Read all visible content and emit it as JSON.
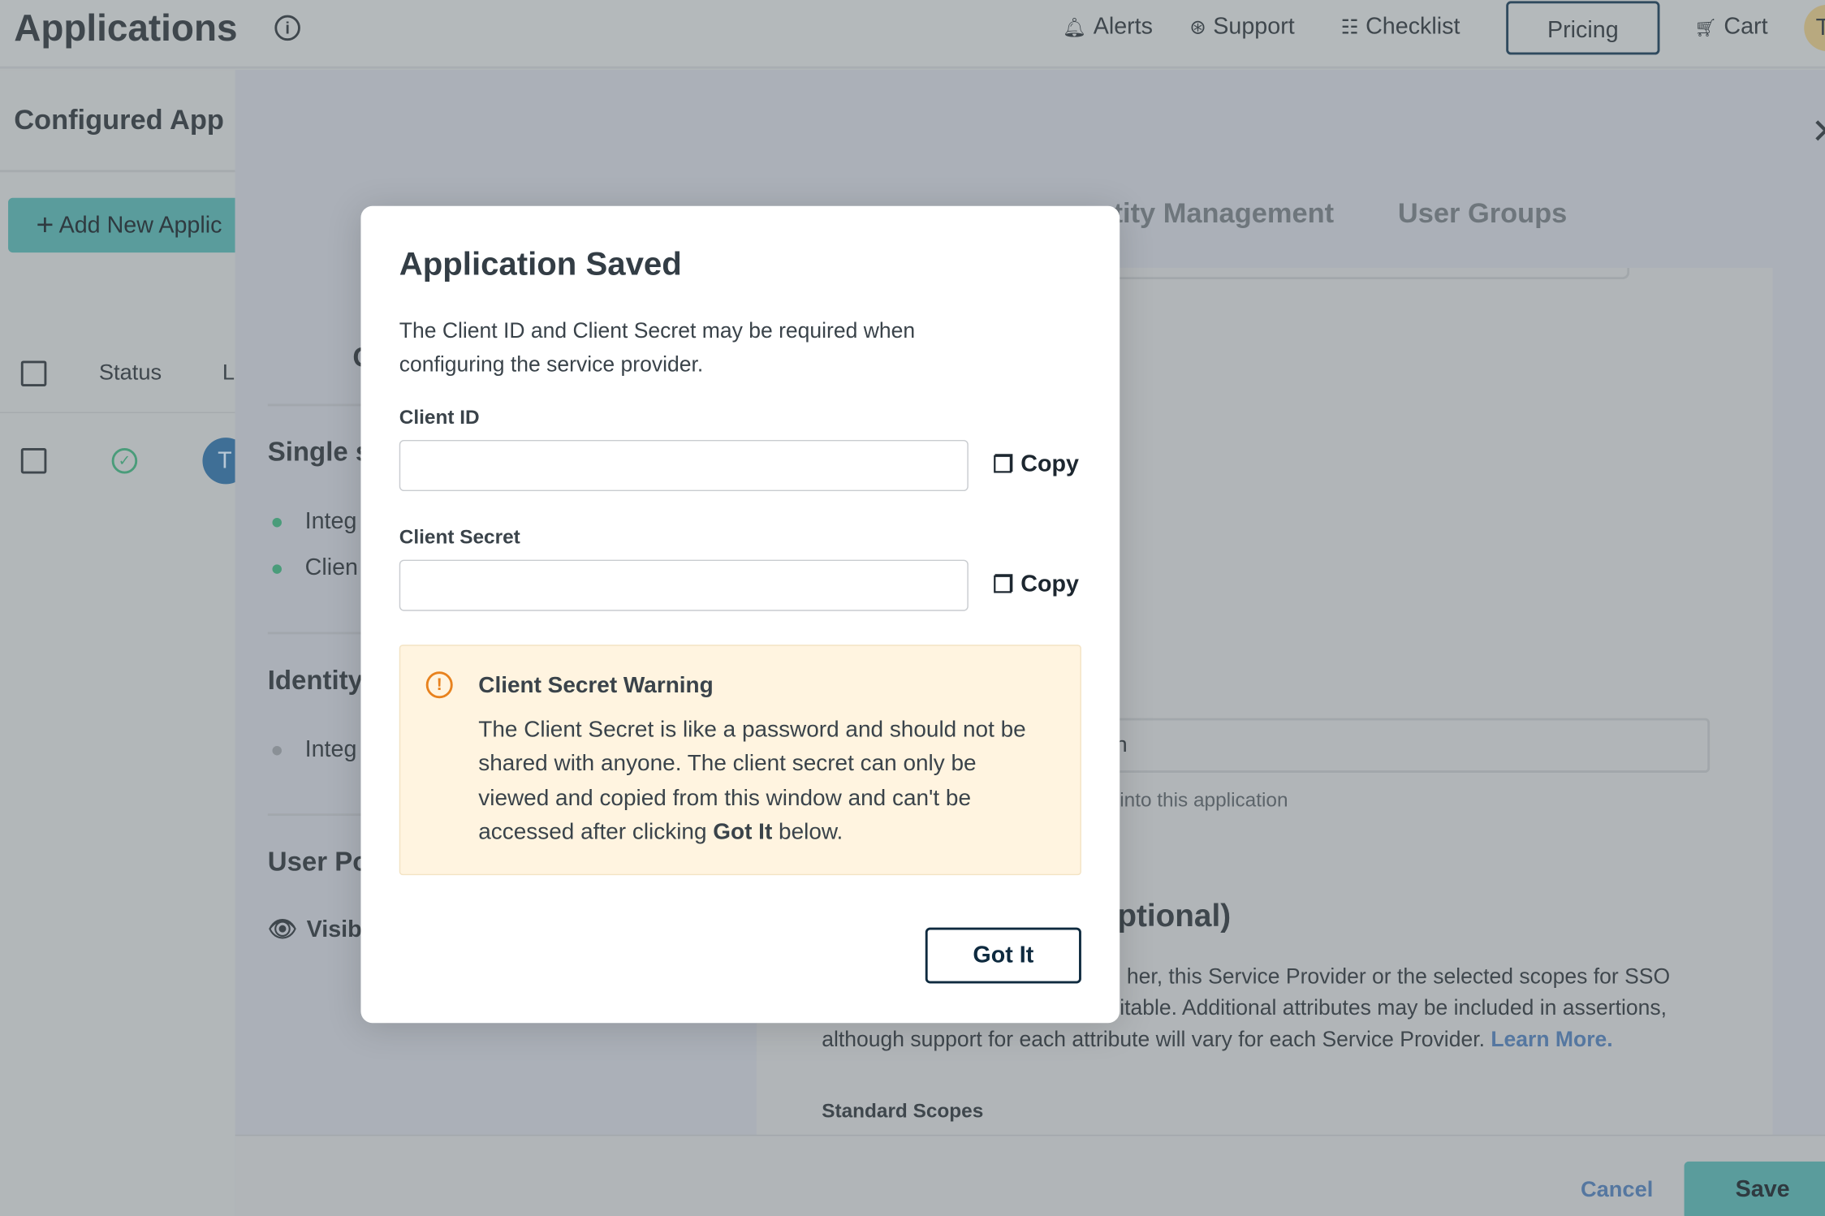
{
  "header": {
    "title": "Applications",
    "nav": [
      {
        "label": "Alerts",
        "icon": "bell-icon"
      },
      {
        "label": "Support",
        "icon": "lifebuoy-icon"
      },
      {
        "label": "Checklist",
        "icon": "checklist-icon"
      }
    ],
    "pricing": "Pricing",
    "cart": "Cart",
    "avatar": "T"
  },
  "left": {
    "title": "Configured App",
    "add_button": "Add New Applic",
    "columns": {
      "status": "Status",
      "l": "L"
    },
    "row": {
      "avatar": "T"
    }
  },
  "drawer": {
    "tabs": [
      "ntity Management",
      "User Groups"
    ],
    "heading_c": "C",
    "sections": [
      {
        "title": "Single s",
        "items": [
          "Integ",
          "Clien"
        ]
      },
      {
        "title": "Identity",
        "items": [
          "Integ"
        ]
      },
      {
        "title": "User Po",
        "items": [
          "Visibl"
        ]
      }
    ],
    "right": {
      "input_fragment": "n",
      "helper": "into this application",
      "optional_heading": "ptional)",
      "para": [
        "her, this Service Provider or the selected scopes for SSO",
        "itable. Additional attributes may be included in assertions,",
        "although support for each attribute will vary for each Service Provider."
      ],
      "learn_more": "Learn More.",
      "standard_scopes": "Standard Scopes"
    },
    "footer": {
      "cancel": "Cancel",
      "save": "Save"
    }
  },
  "modal": {
    "title": "Application Saved",
    "desc_lines": [
      "The Client ID and Client Secret may be required when",
      "configuring the service provider."
    ],
    "client_id_label": "Client ID",
    "client_id_value": "",
    "client_secret_label": "Client Secret",
    "client_secret_value": "",
    "copy": "Copy",
    "warning": {
      "title": "Client Secret Warning",
      "lines": [
        "The Client Secret is like a password and should not be",
        "shared with anyone. The client secret can only be",
        "viewed and copied from this window and can't be"
      ],
      "last_pre": "accessed after clicking ",
      "last_bold": "Got It",
      "last_post": " below."
    },
    "got_it": "Got It"
  },
  "colors": {
    "teal": "#5a9c9c",
    "warning_bg": "#fff4e0",
    "warning_icon": "#e8821e",
    "link": "#5577a0",
    "success": "#4a9c7a"
  }
}
